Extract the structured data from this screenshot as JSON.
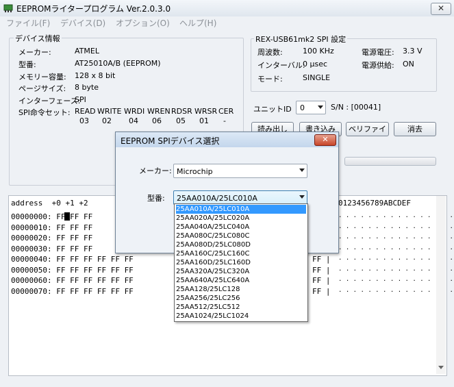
{
  "window": {
    "title": "EEPROMライタープログラム  Ver.2.0.3.0",
    "close_glyph": "✕"
  },
  "menu": [
    "ファイル(F)",
    "デバイス(D)",
    "オプション(O)",
    "ヘルプ(H)"
  ],
  "device_info": {
    "legend": "デバイス情報",
    "rows": [
      {
        "label": "メーカー:",
        "value": "ATMEL"
      },
      {
        "label": "型番:",
        "value": "AT25010A/B  (EEPROM)"
      },
      {
        "label": "メモリー容量:",
        "value": "128 x 8 bit"
      },
      {
        "label": "ページサイズ:",
        "value": "8 byte"
      },
      {
        "label": "インターフェース:",
        "value": "SPI"
      }
    ],
    "spi_label": "SPI命令セット:",
    "spi_cmds": [
      {
        "name": "READ",
        "code": "03"
      },
      {
        "name": "WRITE",
        "code": "02"
      },
      {
        "name": "WRDI",
        "code": "04"
      },
      {
        "name": "WREN",
        "code": "06"
      },
      {
        "name": "RDSR",
        "code": "05"
      },
      {
        "name": "WRSR",
        "code": "01"
      },
      {
        "name": "CER",
        "code": "-"
      }
    ]
  },
  "spi_settings": {
    "legend": "REX-USB61mk2 SPI 設定",
    "freq_label": "周波数:",
    "freq_value": "100 KHz",
    "interval_label": "インターバル:",
    "interval_value": "0 μsec",
    "mode_label": "モード:",
    "mode_value": "SINGLE",
    "voltage_label": "電源電圧:",
    "voltage_value": "3.3 V",
    "supply_label": "電源供給:",
    "supply_value": "ON"
  },
  "unit": {
    "label": "ユニットID",
    "value": "0",
    "sn": "S/N : [00041]"
  },
  "buttons": {
    "read": "読み出し",
    "write": "書き込み",
    "verify": "ベリファイ",
    "erase": "消去"
  },
  "hex": {
    "header_left": "address  +0 +1 +2",
    "header_right": "0123456789ABCDEF",
    "rows": [
      {
        "left": "00000000: FF FF FF",
        "mid": "",
        "right": ". . . . . . . . . . . . . . . ."
      },
      {
        "left": "00000010: FF FF FF",
        "mid": "",
        "right": ". . . . . . . . . . . . . . . ."
      },
      {
        "left": "00000020: FF FF FF",
        "mid": "",
        "right": ". . . . . . . . . . . . . . . ."
      },
      {
        "left": "00000030: FF FF FF",
        "mid": "",
        "right": ". . . . . . . . . . . . . . . ."
      },
      {
        "left": "00000040: FF FF FF FF FF FF",
        "mid": "FF |",
        "right": ". . . . . . . . . . . . . . . ."
      },
      {
        "left": "00000050: FF FF FF FF FF FF",
        "mid": "FF |",
        "right": ". . . . . . . . . . . . . . . ."
      },
      {
        "left": "00000060: FF FF FF FF FF FF",
        "mid": "FF |",
        "right": ". . . . . . . . . . . . . . . ."
      },
      {
        "left": "00000070: FF FF FF FF FF FF",
        "mid": "FF |",
        "right": ". . . . . . . . . . . . . . . ."
      }
    ]
  },
  "dialog": {
    "title": "EEPROM SPIデバイス選択",
    "maker_label": "メーカー:",
    "maker_value": "Microchip",
    "model_label": "型番:",
    "model_value": "25AA010A/25LC010A",
    "options": [
      "25AA010A/25LC010A",
      "25AA020A/25LC020A",
      "25AA040A/25LC040A",
      "25AA080C/25LC080C",
      "25AA080D/25LC080D",
      "25AA160C/25LC160C",
      "25AA160D/25LC160D",
      "25AA320A/25LC320A",
      "25AA640A/25LC640A",
      "25AA128/25LC128",
      "25AA256/25LC256",
      "25AA512/25LC512",
      "25AA1024/25LC1024"
    ],
    "selected_index": 0
  },
  "icons": {
    "app": "chip-icon",
    "dropdown": "chevron-down-icon"
  },
  "colors": {
    "selection": "#3399ff",
    "dialog_close": "#c8462a",
    "menu_disabled": "#8a8f96"
  }
}
